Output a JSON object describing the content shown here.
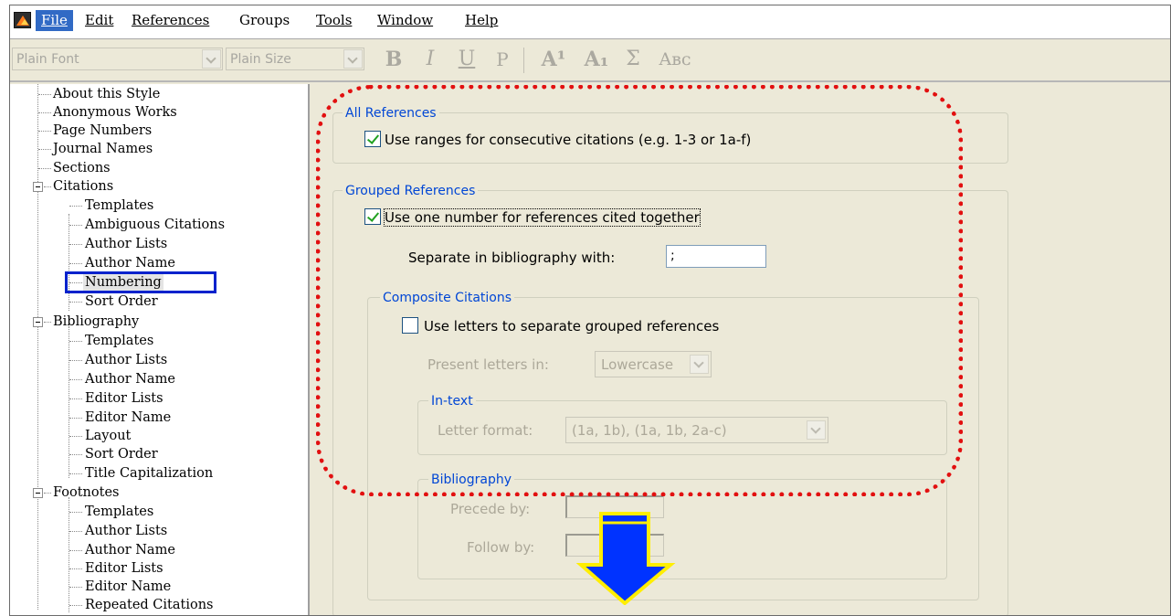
{
  "menu": {
    "items": [
      {
        "label": "File",
        "active": true
      },
      {
        "label": "Edit"
      },
      {
        "label": "References"
      },
      {
        "label": "Groups"
      },
      {
        "label": "Tools"
      },
      {
        "label": "Window"
      },
      {
        "label": "Help"
      }
    ]
  },
  "toolbar": {
    "font_combo": "Plain Font",
    "size_combo": "Plain Size",
    "bold": "B",
    "italic": "I",
    "underline": "U",
    "plain": "P",
    "superscript": "A¹",
    "subscript": "A₁",
    "symbol": "Σ",
    "smallcaps": "Aʙᴄ"
  },
  "tree": {
    "items": [
      {
        "label": "About this Style"
      },
      {
        "label": "Anonymous Works"
      },
      {
        "label": "Page Numbers"
      },
      {
        "label": "Journal Names"
      },
      {
        "label": "Sections"
      },
      {
        "label": "Citations"
      },
      {
        "label": "Templates"
      },
      {
        "label": "Ambiguous Citations"
      },
      {
        "label": "Author Lists"
      },
      {
        "label": "Author Name"
      },
      {
        "label": "Numbering"
      },
      {
        "label": "Sort Order"
      },
      {
        "label": "Bibliography"
      },
      {
        "label": "Templates"
      },
      {
        "label": "Author Lists"
      },
      {
        "label": "Author Name"
      },
      {
        "label": "Editor Lists"
      },
      {
        "label": "Editor Name"
      },
      {
        "label": "Layout"
      },
      {
        "label": "Sort Order"
      },
      {
        "label": "Title Capitalization"
      },
      {
        "label": "Footnotes"
      },
      {
        "label": "Templates"
      },
      {
        "label": "Author Lists"
      },
      {
        "label": "Author Name"
      },
      {
        "label": "Editor Lists"
      },
      {
        "label": "Editor Name"
      },
      {
        "label": "Repeated Citations"
      }
    ]
  },
  "panel": {
    "all_refs": {
      "title": "All References",
      "ranges_label": "Use ranges for consecutive citations (e.g. 1-3 or 1a-f)",
      "ranges_checked": true
    },
    "grouped": {
      "title": "Grouped References",
      "one_number_label": "Use one number for references cited together",
      "one_number_checked": true,
      "separate_label": "Separate in bibliography with:",
      "separate_value": ";"
    },
    "composite": {
      "title": "Composite Citations",
      "letters_label": "Use letters to separate grouped references",
      "letters_checked": false,
      "present_label": "Present letters in:",
      "present_value": "Lowercase",
      "intext_title": "In-text",
      "letter_format_label": "Letter format:",
      "letter_format_value": "(1a, 1b), (1a, 1b, 2a-c)",
      "biblio_title": "Bibliography",
      "precede_label": "Precede by:",
      "follow_label": "Follow by:"
    }
  },
  "colors": {
    "annotation_outline": "#e21010",
    "selection_box": "#0022cc",
    "arrow_fill": "#0033ff",
    "arrow_outline": "#ffee00"
  }
}
